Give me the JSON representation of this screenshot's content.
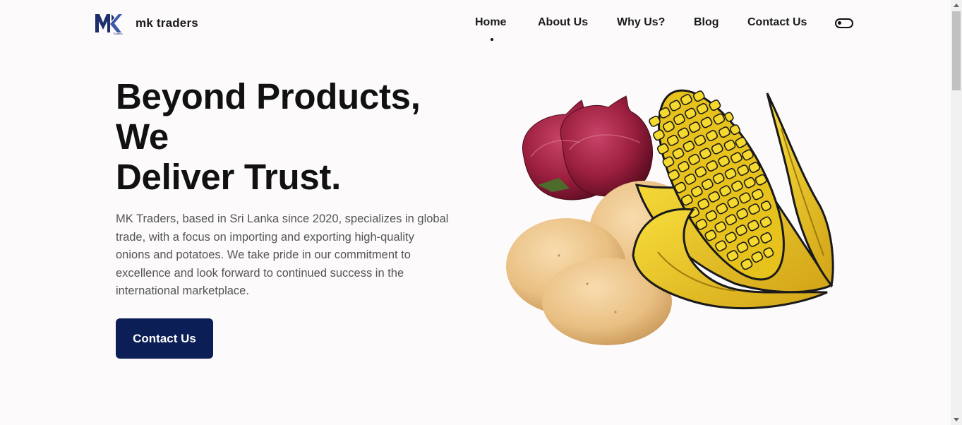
{
  "brand": {
    "logo_text": "MK",
    "logo_subtext": "Traders",
    "name": "mk traders"
  },
  "nav": {
    "items": [
      {
        "label": "Home",
        "active": true
      },
      {
        "label": "About Us"
      },
      {
        "label": "Why Us?"
      },
      {
        "label": "Blog"
      },
      {
        "label": "Contact Us"
      }
    ],
    "theme_toggle_icon": "toggle-switch-icon"
  },
  "hero": {
    "title_lines": [
      "Beyond Products,",
      "We",
      "Deliver Trust."
    ],
    "description": "MK Traders, based in Sri Lanka since 2020, specializes in global trade, with a focus on importing and exporting high-quality onions and potatoes. We take pride in our commitment to excellence and look forward to continued success in the international marketplace.",
    "cta_label": "Contact Us",
    "image_subjects": [
      "red onions",
      "potatoes",
      "corn cob"
    ]
  },
  "colors": {
    "primary": "#0b1e55",
    "background": "#fcfafa",
    "text": "#111111",
    "muted_text": "#555555"
  }
}
